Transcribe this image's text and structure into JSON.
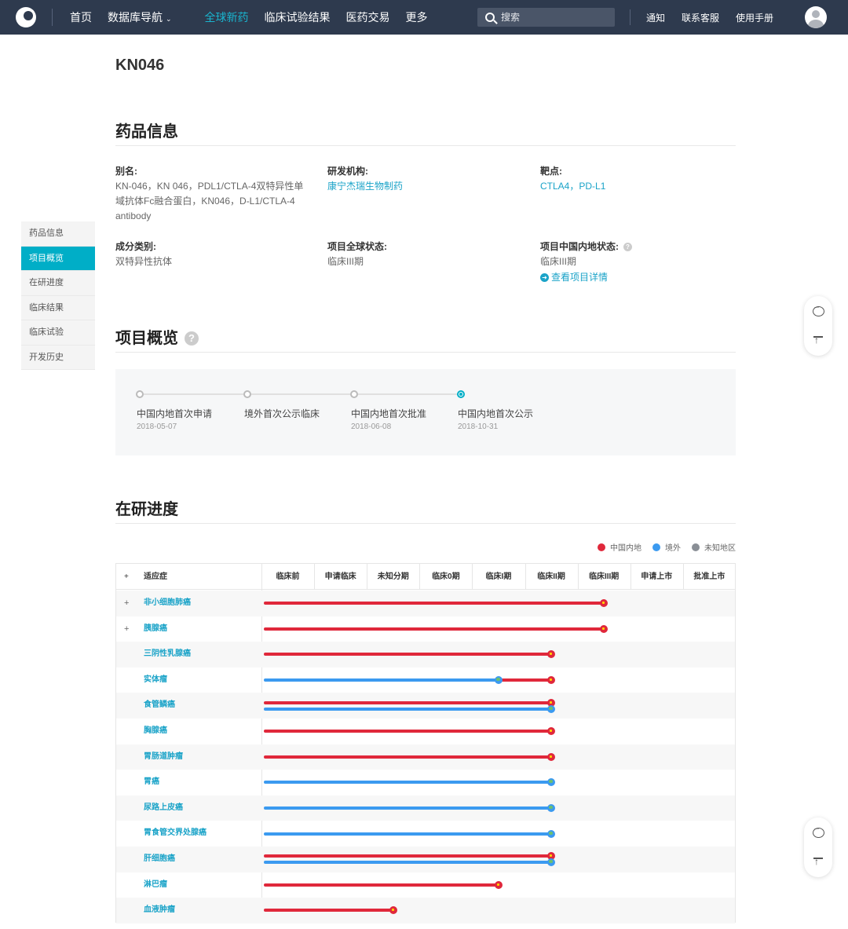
{
  "nav": {
    "items": [
      {
        "label": "首页",
        "active": false
      },
      {
        "label": "数据库导航",
        "active": false,
        "caret": "⌄"
      },
      {
        "label": "全球新药",
        "active": true
      },
      {
        "label": "临床试验结果",
        "active": false
      },
      {
        "label": "医药交易",
        "active": false
      },
      {
        "label": "更多",
        "active": false
      }
    ],
    "search_placeholder": "搜索",
    "right_links": [
      "通知",
      "联系客服",
      "使用手册"
    ]
  },
  "sidemenu": {
    "items": [
      "药品信息",
      "项目概览",
      "在研进度",
      "临床结果",
      "临床试验",
      "开发历史"
    ],
    "active_index": 1
  },
  "drug": {
    "title": "KN046"
  },
  "drug_info": {
    "section_title": "药品信息",
    "alias_label": "别名:",
    "alias_lines": [
      "KN-046，KN 046，PDL1/CTLA-4双特异性单",
      "域抗体Fc融合蛋白，KN046，D-L1/CTLA-4",
      "antibody"
    ],
    "org_label": "研发机构:",
    "org_value": "康宁杰瑞生物制药",
    "target_label": "靶点:",
    "target_value": "CTLA4，PD-L1",
    "type_label": "成分类别:",
    "type_value": "双特异性抗体",
    "global_status_label": "项目全球状态:",
    "global_status_value": "临床III期",
    "cn_status_label": "项目中国内地状态:",
    "cn_status_value": "临床III期",
    "detail_link": "查看项目详情",
    "help_glyph": "?"
  },
  "overview": {
    "section_title": "项目概览",
    "help_glyph": "?",
    "steps": [
      {
        "label": "中国内地首次申请",
        "date": "2018-05-07",
        "active": false
      },
      {
        "label": "境外首次公示临床",
        "date": "",
        "active": false
      },
      {
        "label": "中国内地首次批准",
        "date": "2018-06-08",
        "active": false
      },
      {
        "label": "中国内地首次公示",
        "date": "2018-10-31",
        "active": true
      }
    ]
  },
  "progress": {
    "section_title": "在研进度",
    "legend": [
      {
        "label": "中国内地",
        "color": "#e0283b",
        "icon": "china-flag-icon"
      },
      {
        "label": "境外",
        "color": "#3b9af0",
        "icon": "globe-icon"
      },
      {
        "label": "未知地区",
        "color": "#8a8f96",
        "icon": "unknown-region-icon"
      }
    ],
    "header_plus": "+",
    "indication_header": "适应症",
    "phases": [
      "临床前",
      "申请临床",
      "未知分期",
      "临床0期",
      "临床I期",
      "临床II期",
      "临床III期",
      "申请上市",
      "批准上市"
    ],
    "rows": [
      {
        "indication": "非小细胞肺癌",
        "expandable": true,
        "cn_phase": 6,
        "abroad_phase": null
      },
      {
        "indication": "胰腺癌",
        "expandable": true,
        "cn_phase": 6,
        "abroad_phase": null
      },
      {
        "indication": "三阴性乳腺癌",
        "expandable": false,
        "cn_phase": 5,
        "abroad_phase": null
      },
      {
        "indication": "实体瘤",
        "expandable": false,
        "cn_phase": 5,
        "abroad_phase": 4
      },
      {
        "indication": "食管鳞癌",
        "expandable": false,
        "cn_phase": 5,
        "abroad_phase": 5
      },
      {
        "indication": "胸腺癌",
        "expandable": false,
        "cn_phase": 5,
        "abroad_phase": null
      },
      {
        "indication": "胃肠道肿瘤",
        "expandable": false,
        "cn_phase": 5,
        "abroad_phase": null
      },
      {
        "indication": "胃癌",
        "expandable": false,
        "cn_phase": null,
        "abroad_phase": 5
      },
      {
        "indication": "尿路上皮癌",
        "expandable": false,
        "cn_phase": null,
        "abroad_phase": 5
      },
      {
        "indication": "胃食管交界处腺癌",
        "expandable": false,
        "cn_phase": null,
        "abroad_phase": 5
      },
      {
        "indication": "肝细胞癌",
        "expandable": false,
        "cn_phase": 5,
        "abroad_phase": 5
      },
      {
        "indication": "淋巴瘤",
        "expandable": false,
        "cn_phase": 4,
        "abroad_phase": null
      },
      {
        "indication": "血液肿瘤",
        "expandable": false,
        "cn_phase": 2,
        "abroad_phase": null
      }
    ]
  }
}
